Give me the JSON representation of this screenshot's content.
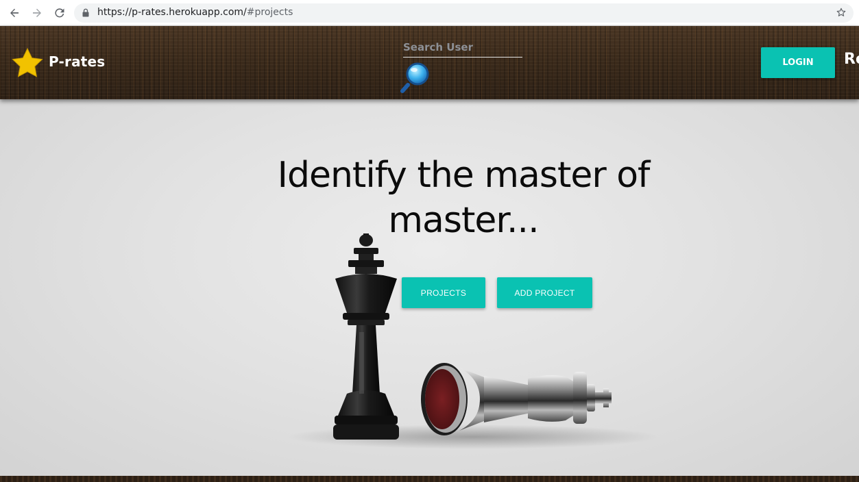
{
  "browser": {
    "url_main": "https://p-rates.herokuapp.com/",
    "url_hash": "#projects"
  },
  "header": {
    "brand": "P-rates",
    "search_placeholder": "Search User",
    "login_label": "LOGIN",
    "register_label": "Re"
  },
  "hero": {
    "headline": "Identify the master of master...",
    "projects_label": "PROJECTS",
    "add_project_label": "ADD PROJECT"
  },
  "colors": {
    "accent": "#0ac2b2",
    "header_wood": "#3b2a1c",
    "star": "#f2c200"
  },
  "icons": {
    "back": "arrow-left-icon",
    "forward": "arrow-right-icon",
    "reload": "reload-icon",
    "lock": "lock-icon",
    "bookmark": "star-outline-icon",
    "logo": "star-icon",
    "search": "magnifier-icon"
  }
}
